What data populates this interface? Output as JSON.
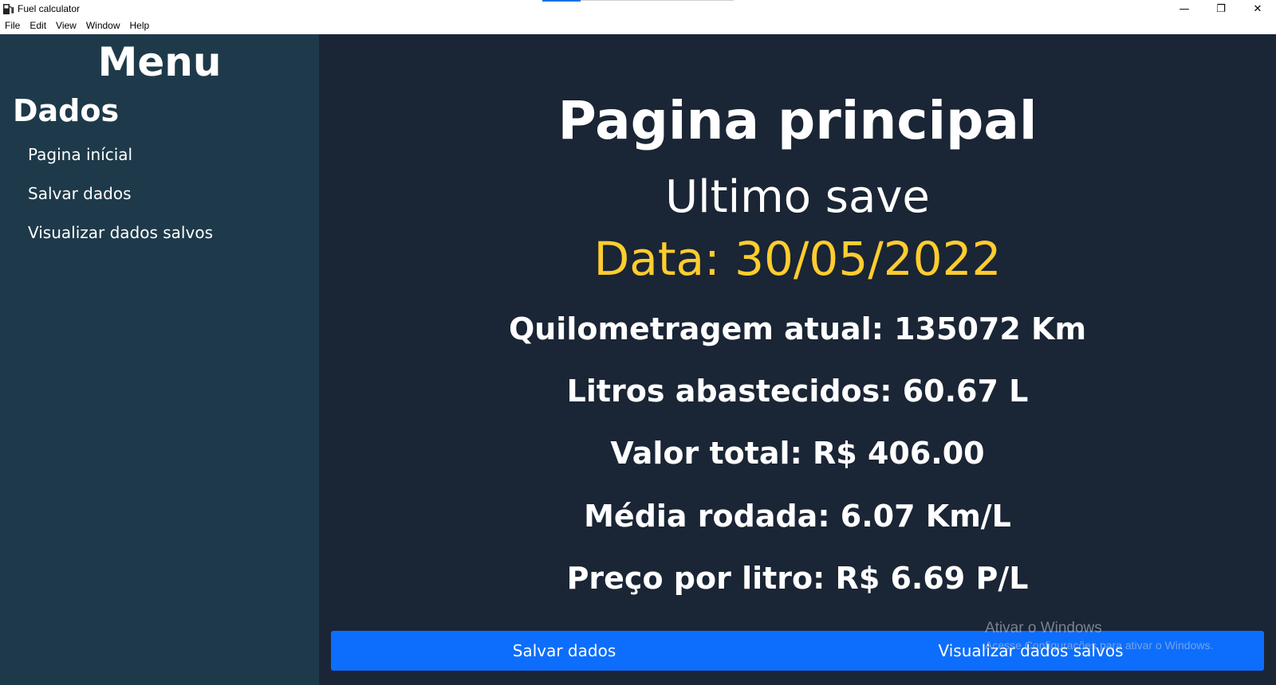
{
  "window": {
    "title": "Fuel calculator",
    "app_icon": "fuel-pump-icon",
    "minimize_glyph": "—",
    "restore_glyph": "❐",
    "close_glyph": "✕"
  },
  "menubar": {
    "items": [
      "File",
      "Edit",
      "View",
      "Window",
      "Help"
    ]
  },
  "sidebar": {
    "title": "Menu",
    "section": "Dados",
    "items": [
      {
        "label": "Pagina inícial"
      },
      {
        "label": "Salvar dados"
      },
      {
        "label": "Visualizar dados salvos"
      }
    ]
  },
  "main": {
    "title": "Pagina principal",
    "subtitle": "Ultimo save",
    "date": "Data: 30/05/2022",
    "stats": [
      "Quilometragem atual: 135072 Km",
      "Litros abastecidos: 60.67 L",
      "Valor total: R$ 406.00",
      "Média rodada: 6.07 Km/L",
      "Preço por litro: R$ 6.69 P/L"
    ],
    "buttons": {
      "save": "Salvar dados",
      "view": "Visualizar dados salvos"
    }
  },
  "watermark": {
    "line1": "Ativar o Windows",
    "line2": "Acesse Configurações para ativar o Windows."
  },
  "colors": {
    "sidebar_bg": "#1e3a4a",
    "main_bg": "#1a2535",
    "date_accent": "#ffcd2e",
    "button_blue": "#0d6efd"
  }
}
